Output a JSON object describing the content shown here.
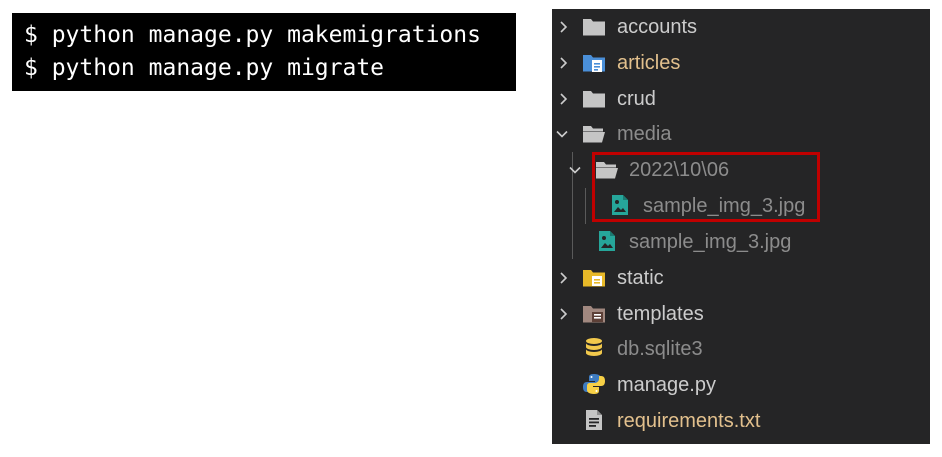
{
  "terminal": {
    "lines": [
      "$ python manage.py makemigrations",
      "$ python manage.py migrate"
    ]
  },
  "explorer": {
    "items": [
      {
        "label": "accounts",
        "icon": "folder-icon",
        "expanded": false
      },
      {
        "label": "articles",
        "icon": "folder-icon",
        "expanded": false
      },
      {
        "label": "crud",
        "icon": "folder-icon",
        "expanded": false
      },
      {
        "label": "media",
        "icon": "folder-open-icon",
        "expanded": true
      },
      {
        "label": "2022\\10\\06",
        "icon": "folder-open-icon",
        "expanded": true
      },
      {
        "label": "sample_img_3.jpg",
        "icon": "image-file-icon"
      },
      {
        "label": "sample_img_3.jpg",
        "icon": "image-file-icon"
      },
      {
        "label": "static",
        "icon": "folder-icon",
        "expanded": false
      },
      {
        "label": "templates",
        "icon": "folder-icon",
        "expanded": false
      },
      {
        "label": "db.sqlite3",
        "icon": "database-icon"
      },
      {
        "label": "manage.py",
        "icon": "python-icon"
      },
      {
        "label": "requirements.txt",
        "icon": "text-file-icon"
      }
    ]
  },
  "colors": {
    "explorer_bg": "#252526",
    "label_default": "#cccccc",
    "label_dimmed": "#8c8c8c",
    "label_modified": "#e2c08d",
    "label_articles": "#e2c08d",
    "folder_grey": "#c5c5c5",
    "articles_blue": "#4a8fd8",
    "static_yellow": "#e8b928",
    "image_teal": "#26a69a",
    "database_yellow": "#f2c94c",
    "highlight_red": "#c00000"
  }
}
